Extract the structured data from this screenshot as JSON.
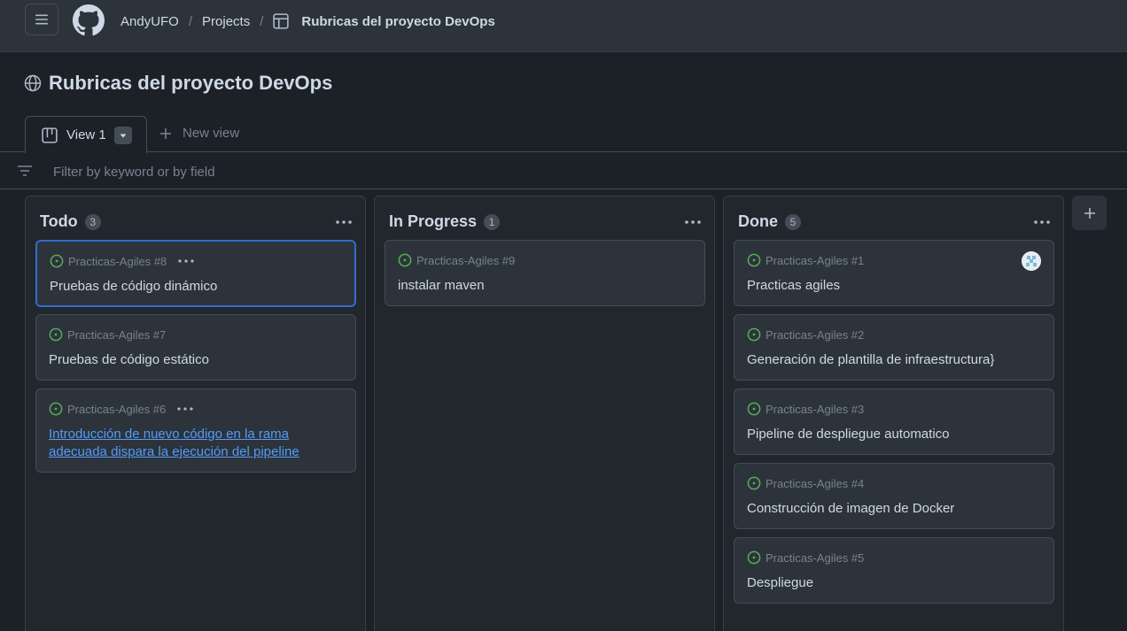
{
  "header": {
    "breadcrumbs": [
      "AndyUFO",
      "Projects",
      "Rubricas del proyecto DevOps"
    ],
    "separator": "/"
  },
  "project": {
    "title": "Rubricas del proyecto DevOps"
  },
  "tabs": {
    "active_label": "View 1",
    "new_view_label": "New view"
  },
  "filter": {
    "placeholder": "Filter by keyword or by field",
    "value": ""
  },
  "colors": {
    "background": "#1c2128",
    "column": "#22272e",
    "card": "#2d333b",
    "accent_blue": "#316dca",
    "link": "#539bf5",
    "open_issue_green": "#57ab5a"
  },
  "columns": [
    {
      "title": "Todo",
      "count": "3",
      "cards": [
        {
          "ref": "Practicas-Agiles #8",
          "title": "Pruebas de código dinámico",
          "selected": true,
          "link": false
        },
        {
          "ref": "Practicas-Agiles #7",
          "title": "Pruebas de código estático",
          "selected": false,
          "link": false
        },
        {
          "ref": "Practicas-Agiles #6",
          "title": "Introducción de nuevo código en la rama adecuada dispara la ejecución del pipeline",
          "selected": false,
          "link": true
        }
      ]
    },
    {
      "title": "In Progress",
      "count": "1",
      "cards": [
        {
          "ref": "Practicas-Agiles #9",
          "title": "instalar maven",
          "selected": false,
          "link": false
        }
      ]
    },
    {
      "title": "Done",
      "count": "5",
      "cards": [
        {
          "ref": "Practicas-Agiles #1",
          "title": "Practicas agiles",
          "selected": false,
          "link": false
        },
        {
          "ref": "Practicas-Agiles #2",
          "title": "Generación de plantilla de infraestructura}",
          "selected": false,
          "link": false
        },
        {
          "ref": "Practicas-Agiles #3",
          "title": "Pipeline de despliegue automatico",
          "selected": false,
          "link": false
        },
        {
          "ref": "Practicas-Agiles #4",
          "title": "Construcción de imagen de Docker",
          "selected": false,
          "link": false
        },
        {
          "ref": "Practicas-Agiles #5",
          "title": "Despliegue",
          "selected": false,
          "link": false
        }
      ]
    }
  ]
}
